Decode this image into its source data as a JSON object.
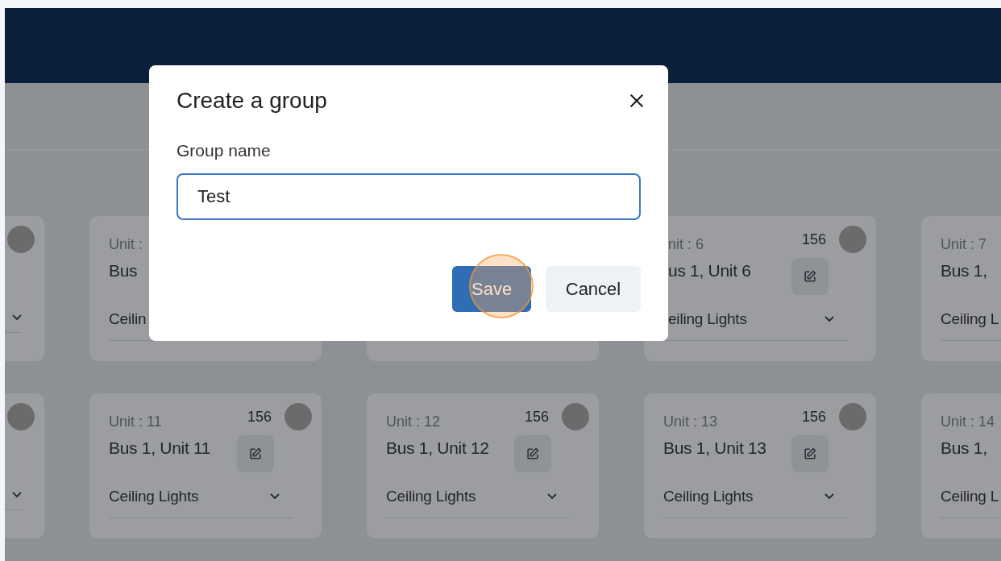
{
  "card_rows": [
    {
      "cards": [
        {
          "kind": "left_edge"
        },
        {
          "kind": "covered",
          "unit_label": "Unit :",
          "name": "Bus",
          "type": "Ceilin"
        },
        {
          "kind": "hidden"
        },
        {
          "kind": "full",
          "unit_label": "nit : 6",
          "name": "us 1, Unit 6",
          "type": "eiling Lights",
          "count": "156",
          "trimmed": true
        },
        {
          "kind": "right_edge",
          "unit_label": "Unit : 7",
          "name": "Bus 1,",
          "type": "Ceiling L"
        }
      ]
    },
    {
      "cards": [
        {
          "kind": "left_edge"
        },
        {
          "kind": "full",
          "unit_label": "Unit : 11",
          "name": "Bus 1, Unit 11",
          "type": "Ceiling Lights",
          "count": "156"
        },
        {
          "kind": "full",
          "unit_label": "Unit : 12",
          "name": "Bus 1, Unit 12",
          "type": "Ceiling Lights",
          "count": "156"
        },
        {
          "kind": "full",
          "unit_label": "Unit : 13",
          "name": "Bus 1, Unit 13",
          "type": "Ceiling Lights",
          "count": "156"
        },
        {
          "kind": "right_edge",
          "unit_label": "Unit : 14",
          "name": "Bus 1,",
          "type": "Ceiling L"
        }
      ]
    }
  ],
  "dialog": {
    "title": "Create a group",
    "field_label": "Group name",
    "field_value": "Test",
    "buttons": [
      {
        "kind": "primary",
        "label": "Save"
      },
      {
        "kind": "secondary",
        "label": "Cancel"
      }
    ]
  }
}
